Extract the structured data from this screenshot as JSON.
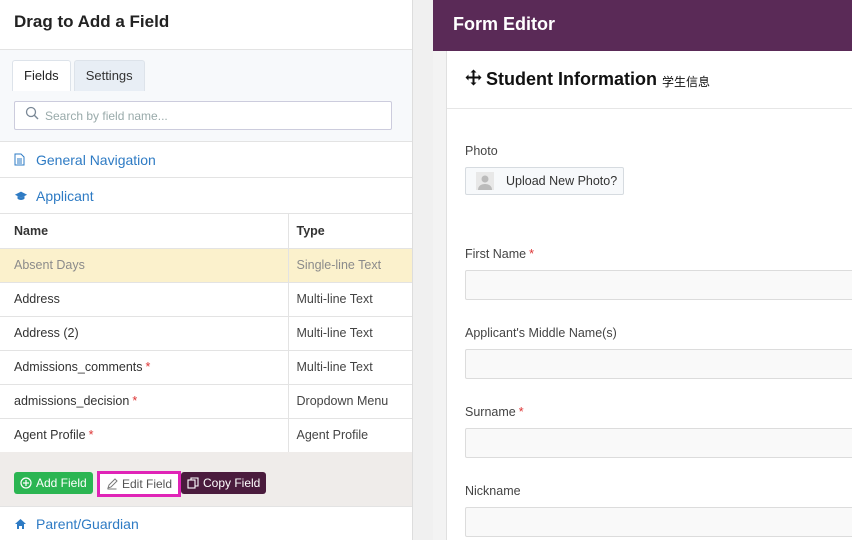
{
  "left_panel": {
    "title": "Drag to Add a Field",
    "tabs": [
      {
        "label": "Fields",
        "active": true
      },
      {
        "label": "Settings",
        "active": false
      }
    ],
    "search_placeholder": "Search by field name...",
    "sections": {
      "general_navigation": "General Navigation",
      "applicant": "Applicant",
      "parent_guardian": "Parent/Guardian"
    },
    "table": {
      "headers": {
        "name": "Name",
        "type": "Type"
      },
      "rows": [
        {
          "name": "Absent Days",
          "type": "Single-line Text",
          "required": false,
          "highlighted": true
        },
        {
          "name": "Address",
          "type": "Multi-line Text",
          "required": false
        },
        {
          "name": "Address (2)",
          "type": "Multi-line Text",
          "required": false
        },
        {
          "name": "Admissions_comments",
          "type": "Multi-line Text",
          "required": true
        },
        {
          "name": "admissions_decision",
          "type": "Dropdown Menu",
          "required": true
        },
        {
          "name": "Agent Profile",
          "type": "Agent Profile",
          "required": true
        }
      ],
      "required_marker": "*"
    },
    "actions": {
      "add_field": "Add Field",
      "edit_field": "Edit Field",
      "copy_field": "Copy Field"
    }
  },
  "form_editor": {
    "header": "Form Editor",
    "section_title": "Student Information",
    "section_subtitle": "学生信息",
    "fields": {
      "photo_label": "Photo",
      "photo_button": "Upload New Photo?",
      "first_name": "First Name",
      "middle_name": "Applicant's Middle Name(s)",
      "surname": "Surname",
      "nickname": "Nickname"
    },
    "required_marker": "*"
  },
  "colors": {
    "header_bg": "#5a2a57",
    "link": "#2e7bc4",
    "add_button": "#2bb552",
    "copy_button": "#4a1b3d",
    "edit_highlight": "#e024b7",
    "row_highlight": "#fbf1cc",
    "required": "#d33333"
  }
}
